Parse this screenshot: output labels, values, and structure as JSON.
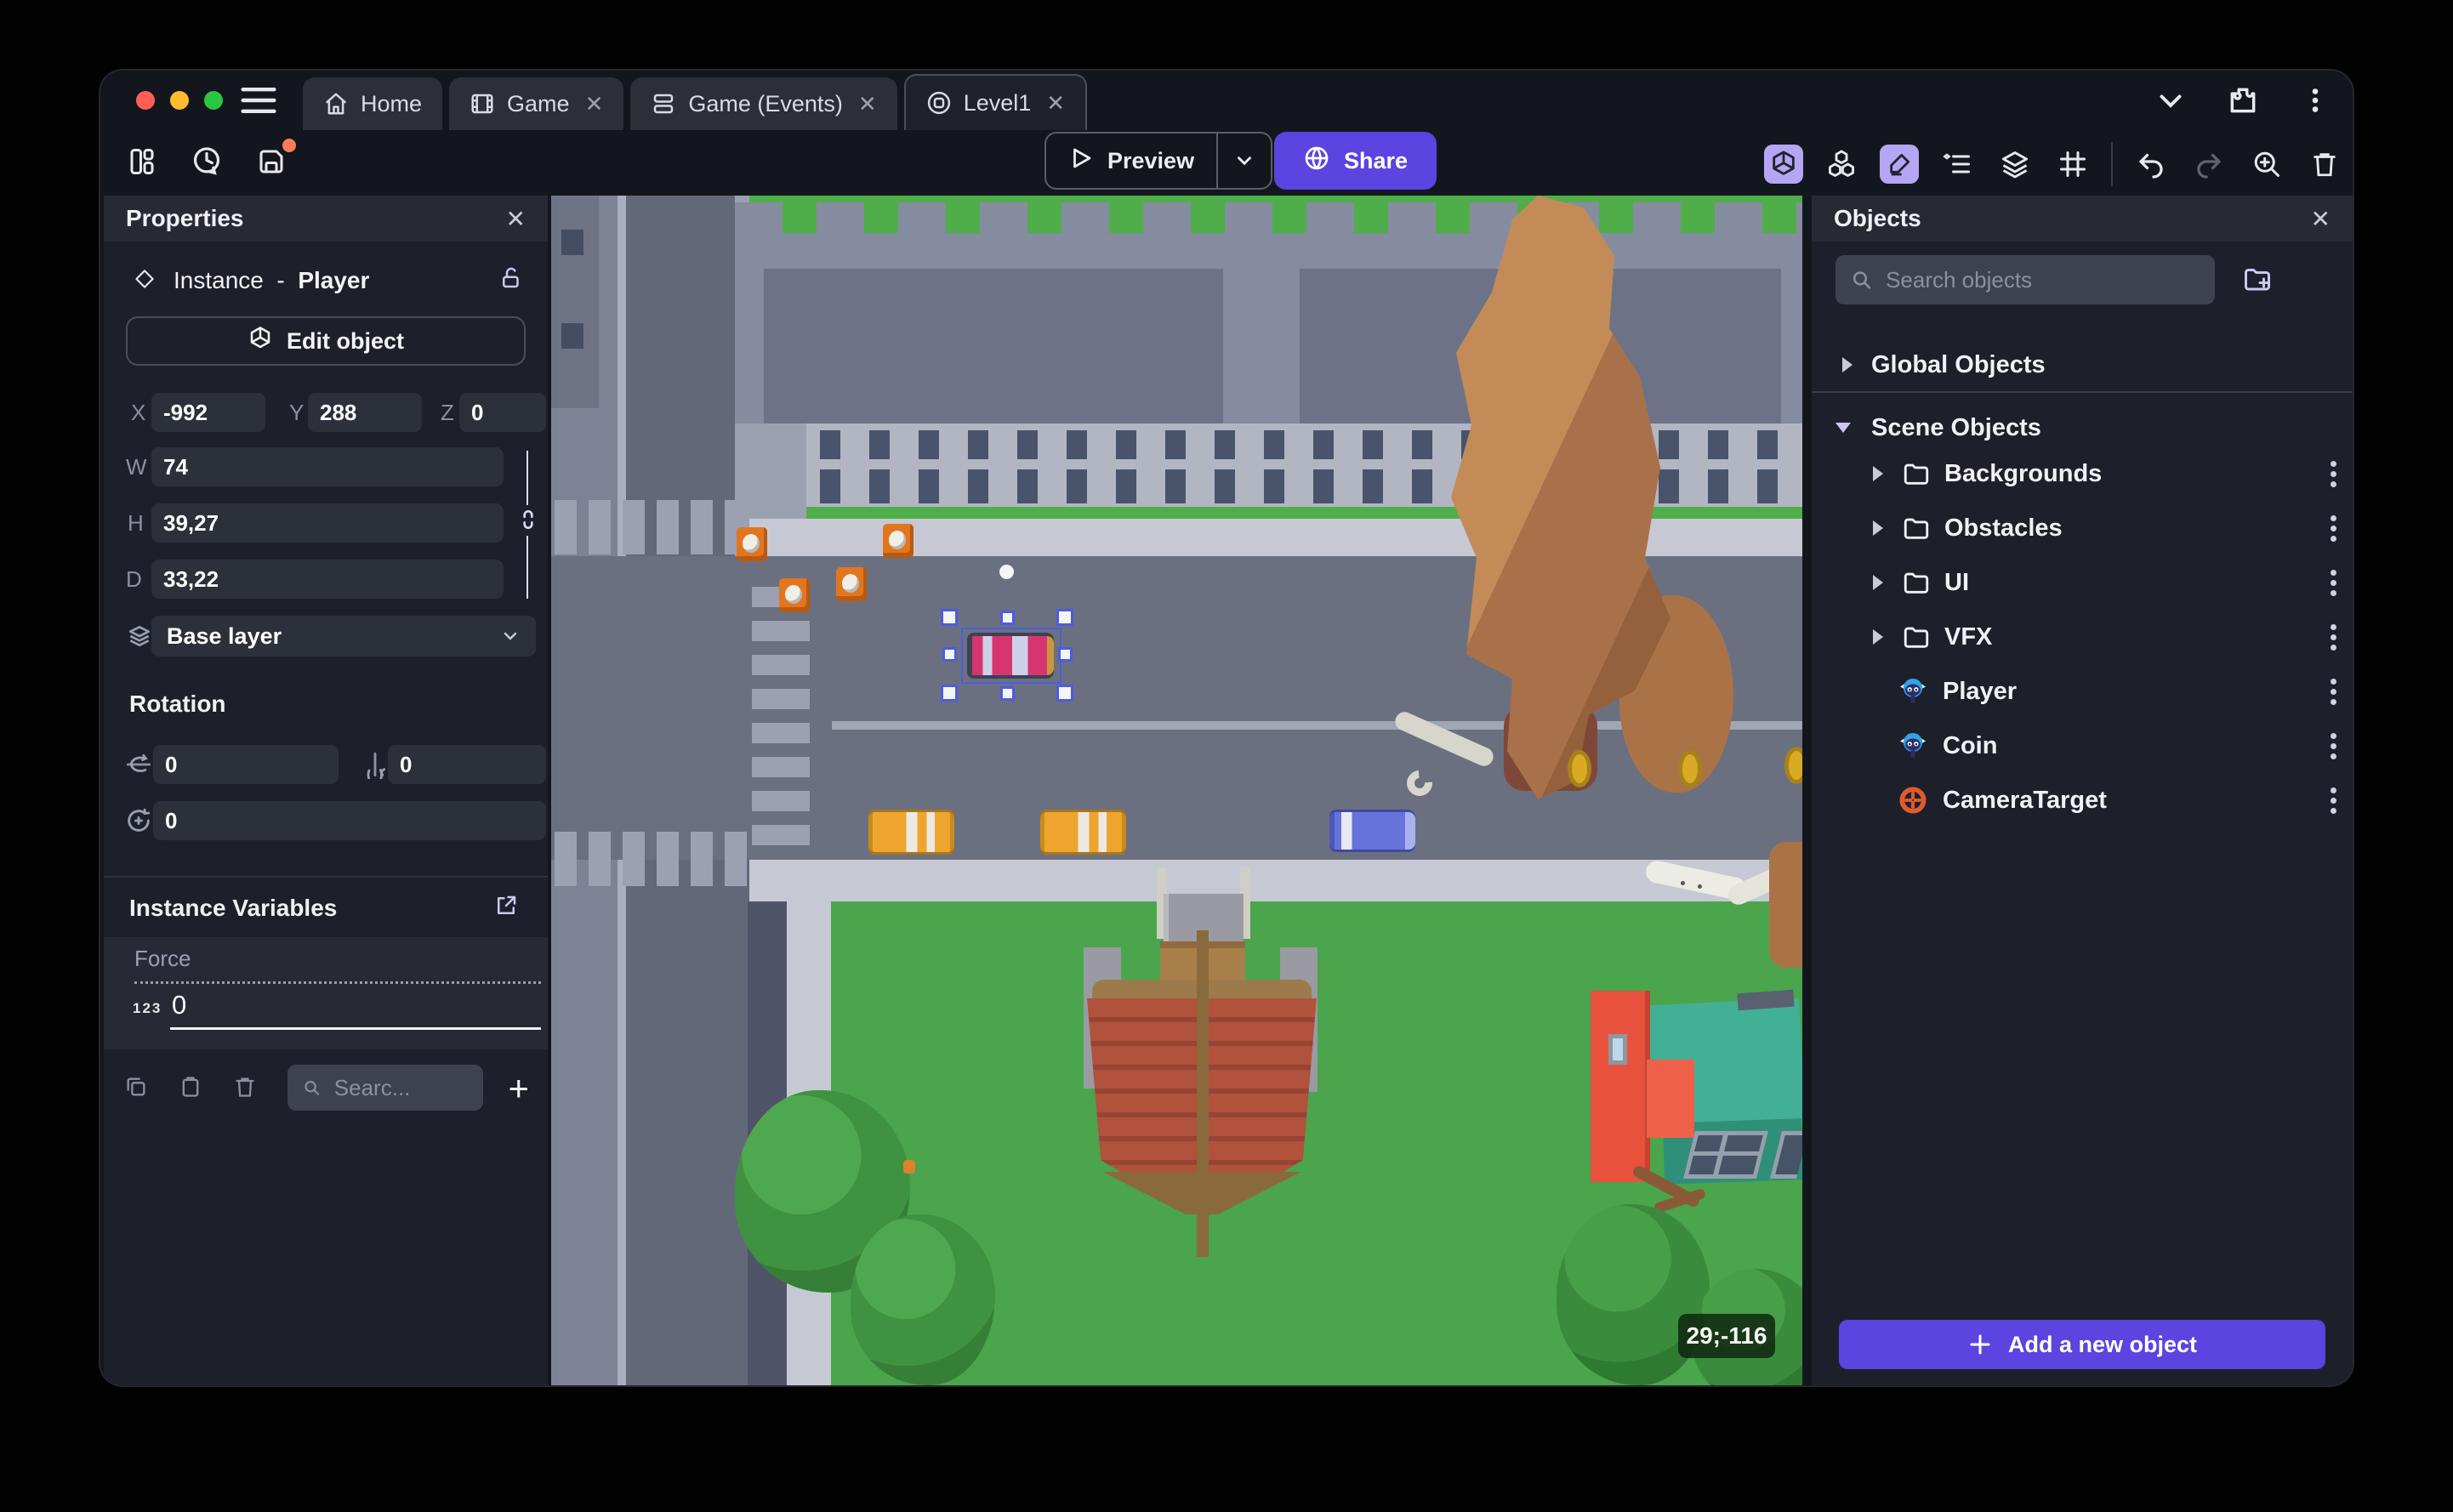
{
  "window": {
    "traffic_lights": [
      "#ff5f57",
      "#febc2e",
      "#28c840"
    ]
  },
  "titlebar": {
    "tabs": [
      {
        "label": "Home",
        "icon": "home-icon",
        "closable": false,
        "active": false
      },
      {
        "label": "Game",
        "icon": "film-icon",
        "closable": true,
        "active": false
      },
      {
        "label": "Game (Events)",
        "icon": "events-icon",
        "closable": true,
        "active": false
      },
      {
        "label": "Level1",
        "icon": "scene-icon",
        "closable": true,
        "active": true
      }
    ],
    "close_glyph": "✕"
  },
  "toolbar": {
    "preview_label": "Preview",
    "share_label": "Share"
  },
  "properties": {
    "title": "Properties",
    "instance_type": "Instance",
    "separator": "-",
    "instance_name": "Player",
    "edit_object_label": "Edit object",
    "x_label": "X",
    "x_value": "-992",
    "y_label": "Y",
    "y_value": "288",
    "z_label": "Z",
    "z_value": "0",
    "w_label": "W",
    "w_value": "74",
    "h_label": "H",
    "h_value": "39,27",
    "d_label": "D",
    "d_value": "33,22",
    "layer_value": "Base layer",
    "rotation_title": "Rotation",
    "rotation_x": "0",
    "rotation_y": "0",
    "rotation_z": "0",
    "variables_title": "Instance Variables",
    "variable_name": "Force",
    "variable_type_badge": "123",
    "variable_value": "0",
    "search_placeholder": "Searc..."
  },
  "objects_panel": {
    "title": "Objects",
    "search_placeholder": "Search objects",
    "global_group_label": "Global Objects",
    "scene_group_label": "Scene Objects",
    "rows": [
      {
        "label": "Backgrounds",
        "kind": "folder"
      },
      {
        "label": "Obstacles",
        "kind": "folder"
      },
      {
        "label": "UI",
        "kind": "folder"
      },
      {
        "label": "VFX",
        "kind": "folder"
      },
      {
        "label": "Player",
        "kind": "object",
        "icon": "monkey-icon"
      },
      {
        "label": "Coin",
        "kind": "object",
        "icon": "monkey-icon"
      },
      {
        "label": "CameraTarget",
        "kind": "object",
        "icon": "crosshair-icon"
      }
    ],
    "add_button_label": "Add a new object"
  },
  "scene": {
    "cursor_coordinates_badge": "29;-116"
  },
  "colors": {
    "accent_purple": "#5b44e0",
    "active_tool_bg": "#b5a6f5",
    "unsaved_dot": "#ff7a59",
    "selection_blue": "#4d5ce0",
    "grass_green": "#4aa54d",
    "road_gray": "#6b7080",
    "sidewalk": "#c6c9d4",
    "brick_red": "#b0523c",
    "player_car_pink": "#d6366f",
    "taxi_yellow": "#eda52d",
    "npc_car_blue": "#6673da",
    "coin_gold": "#d9ab25",
    "crate_orange": "#e2761f"
  }
}
